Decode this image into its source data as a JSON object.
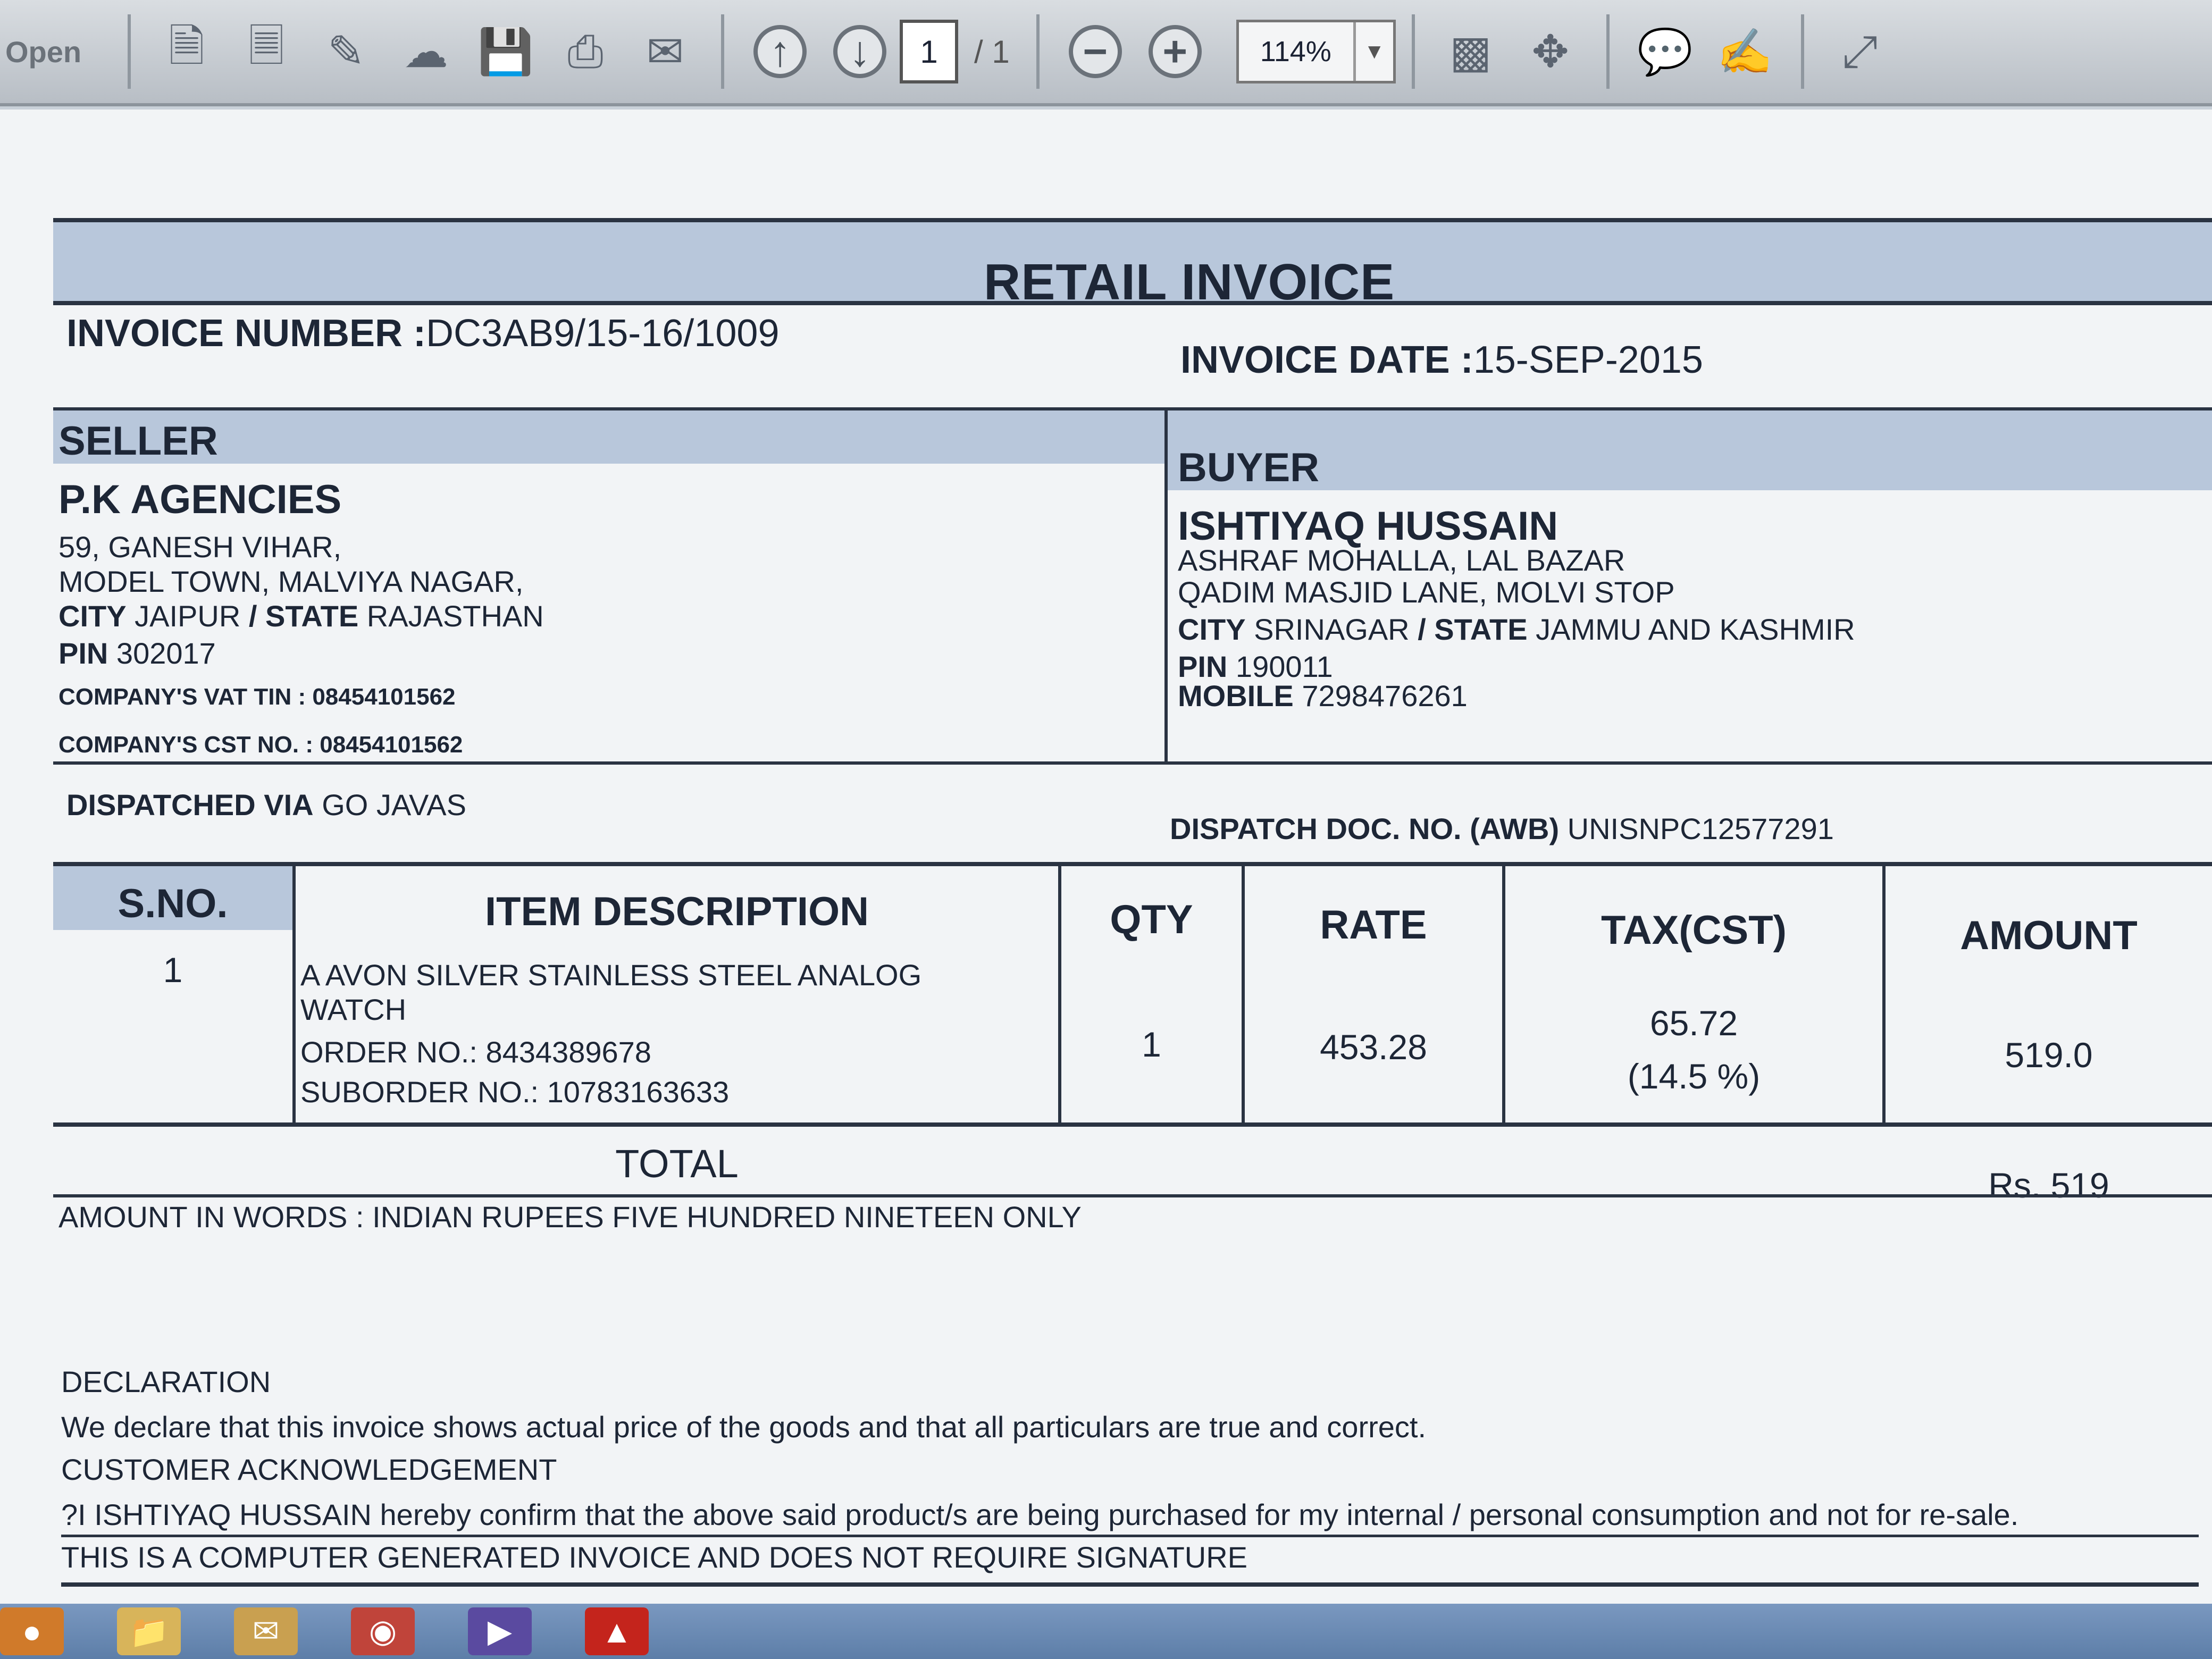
{
  "toolbar": {
    "open_label": "Open",
    "page_current": "1",
    "page_total": "/ 1",
    "zoom": "114%"
  },
  "invoice": {
    "title": "RETAIL INVOICE",
    "number_label": "INVOICE NUMBER :",
    "number_value": "DC3AB9/15-16/1009",
    "date_label": "INVOICE DATE :",
    "date_value": "15-SEP-2015",
    "seller": {
      "heading": "SELLER",
      "name": "P.K AGENCIES",
      "address1": "59, GANESH VIHAR,",
      "address2": "MODEL TOWN, MALVIYA NAGAR,",
      "city_label": "CITY",
      "city": "JAIPUR",
      "state_label": "/ STATE",
      "state": "RAJASTHAN",
      "pin_label": "PIN",
      "pin": "302017",
      "vat_tin": "COMPANY'S VAT TIN : 08454101562",
      "cst_no": "COMPANY'S CST NO. : 08454101562"
    },
    "buyer": {
      "heading": "BUYER",
      "name": "ISHTIYAQ HUSSAIN",
      "address1": "ASHRAF MOHALLA, LAL BAZAR",
      "address2": "QADIM MASJID LANE, MOLVI STOP",
      "city_label": "CITY",
      "city": "SRINAGAR",
      "state_label": "/ STATE",
      "state": "JAMMU AND KASHMIR",
      "pin_label": "PIN",
      "pin": "190011",
      "mobile_label": "MOBILE",
      "mobile": "7298476261"
    },
    "dispatch_via_label": "DISPATCHED VIA",
    "dispatch_via": "GO JAVAS",
    "dispatch_doc_label": "DISPATCH DOC. NO. (AWB)",
    "dispatch_doc": "UNISNPC12577291",
    "table": {
      "headers": [
        "S.NO.",
        "ITEM DESCRIPTION",
        "QTY",
        "RATE",
        "TAX(CST)",
        "AMOUNT"
      ],
      "rows": [
        {
          "sno": "1",
          "desc1": "A AVON SILVER STAINLESS STEEL ANALOG",
          "desc2": "WATCH",
          "order_no": "ORDER NO.: 8434389678",
          "suborder_no": "SUBORDER NO.: 10783163633",
          "qty": "1",
          "rate": "453.28",
          "tax": "65.72",
          "tax_rate": "(14.5 %)",
          "amount": "519.0"
        }
      ]
    },
    "total_label": "TOTAL",
    "total_value": "Rs. 519",
    "amount_in_words": "AMOUNT IN WORDS : INDIAN RUPEES FIVE HUNDRED NINETEEN ONLY",
    "declaration_heading": "DECLARATION",
    "declaration_text": "We declare that this invoice shows actual price of the goods and that all particulars are true and correct.",
    "ack_heading": "CUSTOMER ACKNOWLEDGEMENT",
    "ack_text": "?I ISHTIYAQ HUSSAIN hereby confirm that the above said product/s are being purchased for my internal / personal consumption and not for re-sale.",
    "footer_note": "THIS IS A COMPUTER GENERATED INVOICE AND DOES NOT REQUIRE SIGNATURE"
  }
}
